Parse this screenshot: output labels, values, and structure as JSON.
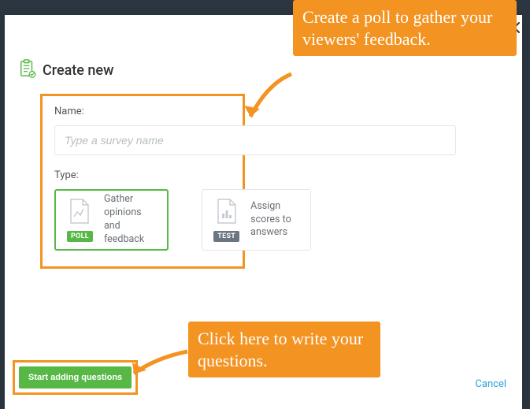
{
  "heading": "Create new",
  "form": {
    "name_label": "Name:",
    "name_placeholder": "Type a survey name",
    "type_label": "Type:"
  },
  "types": {
    "poll": {
      "badge": "POLL",
      "desc": "Gather opinions and feedback"
    },
    "test": {
      "badge": "TEST",
      "desc": "Assign scores to answers"
    }
  },
  "actions": {
    "start": "Start adding questions",
    "cancel": "Cancel"
  },
  "annotations": {
    "top": "Create a poll to gather your viewers' feedback.",
    "bottom": "Click here to write your questions."
  },
  "colors": {
    "accent_green": "#57b846",
    "accent_orange": "#f39321",
    "link_blue": "#2ca0d9"
  }
}
